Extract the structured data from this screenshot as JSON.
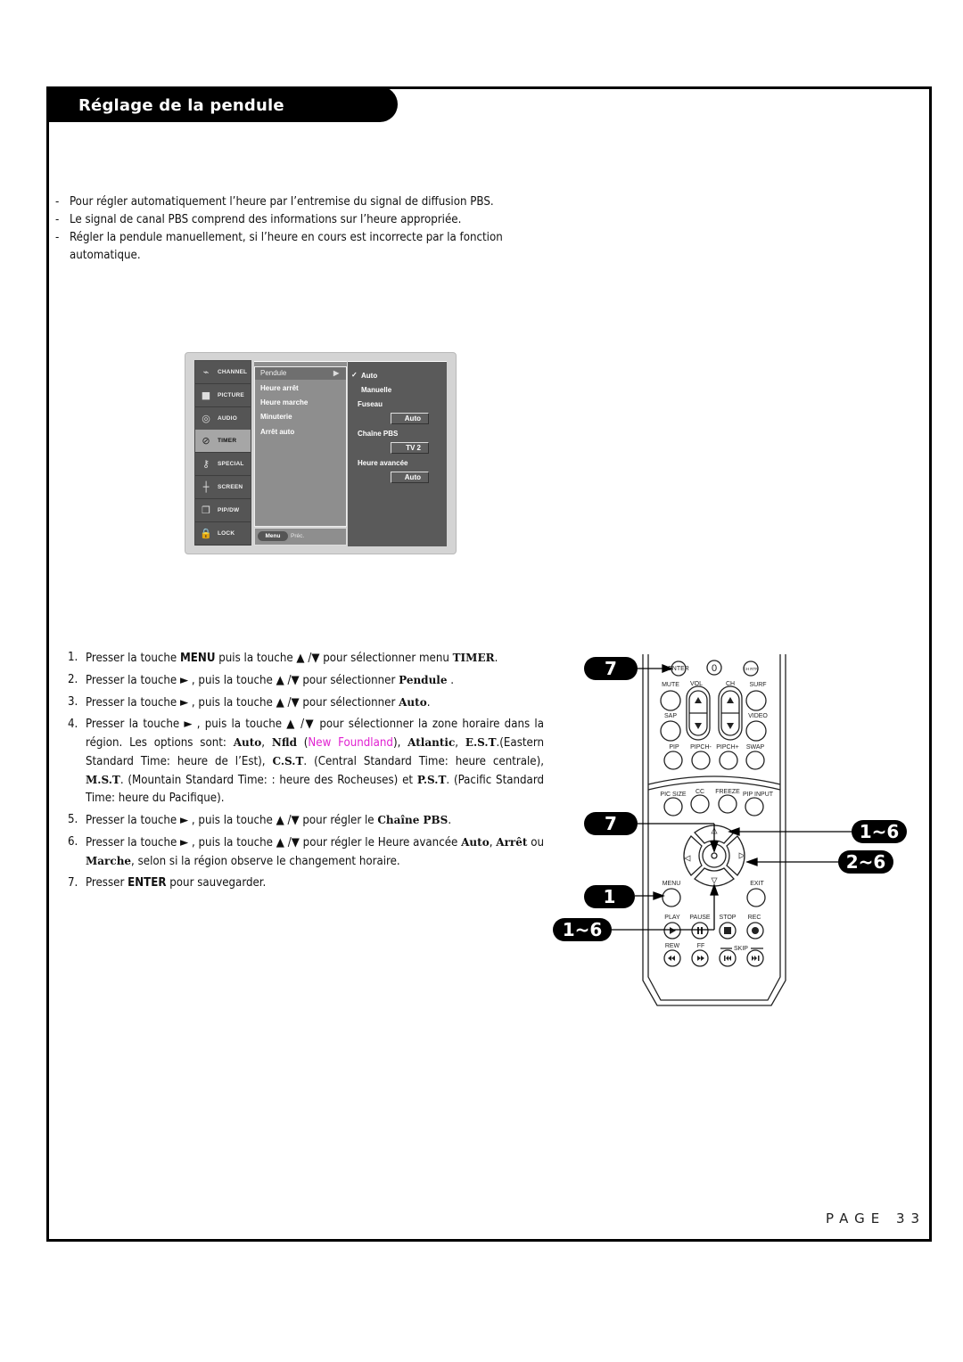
{
  "header": {
    "title": "Réglage de la pendule"
  },
  "intro": [
    "Pour régler automatiquement l’heure par l’entremise du signal de diffusion PBS.",
    "Le signal de canal PBS comprend des informations sur l’heure appropriée.",
    "Régler la pendule manuellement, si l’heure en cours est incorrecte par la fonction automatique."
  ],
  "osd": {
    "sidebar": [
      {
        "label": "CHANNEL",
        "icon": "satellite-dish-icon",
        "active": false
      },
      {
        "label": "PICTURE",
        "icon": "tv-screen-icon",
        "active": false
      },
      {
        "label": "AUDIO",
        "icon": "speaker-icon",
        "active": false
      },
      {
        "label": "TIMER",
        "icon": "clock-dial-icon",
        "active": true
      },
      {
        "label": "SPECIAL",
        "icon": "key-tag-icon",
        "active": false
      },
      {
        "label": "SCREEN",
        "icon": "crosshair-icon",
        "active": false
      },
      {
        "label": "PIP/DW",
        "icon": "pip-windows-icon",
        "active": false
      },
      {
        "label": "LOCK",
        "icon": "padlock-icon",
        "active": false
      }
    ],
    "submenu": [
      "Pendule",
      "Heure arrêt",
      "Heure marche",
      "Minuterie",
      "Arrêt auto"
    ],
    "submenu_arrow": "▶",
    "footer": {
      "menu": "Menu",
      "prev": "Préc."
    },
    "options": {
      "check": "✓",
      "auto": "Auto",
      "manual": "Manuelle",
      "fuseau_label": "Fuseau",
      "fuseau_value": "Auto",
      "pbs_label": "Chaîne PBS",
      "pbs_value": "TV 2",
      "dst_label": "Heure avancée",
      "dst_value": "Auto"
    }
  },
  "steps": {
    "s1": {
      "num": "1.",
      "a": "Presser la touche ",
      "b1": "MENU",
      "c": " puis la touche ▲ /▼ pour sélectionner menu ",
      "b2": "TIMER",
      "d": "."
    },
    "s2": {
      "num": "2.",
      "a": "Presser la touche ► , puis la touche ▲ /▼ pour sélectionner ",
      "b1": "Pendule",
      "d": " ."
    },
    "s3": {
      "num": "3.",
      "a": "Presser la touche ► , puis la touche ▲ /▼ pour sélectionner ",
      "b1": "Auto",
      "d": "."
    },
    "s4": {
      "num": "4.",
      "a": "Presser la touche ► , puis la touche ▲ /▼ pour sélectionner la zone horaire dans la région. Les options sont: ",
      "auto": "Auto",
      "nfld": "Nfld",
      "nf_full": "New Foundland",
      "atl": "Atlantic",
      "est": "E.S.T",
      "est_txt": ".(Eastern Standard Time: heure de l’Est), ",
      "cst": "C.S.T",
      "cst_txt": ". (Central Standard Time: heure centrale), ",
      "mst": "M.S.T",
      "mst_txt": ". (Mountain Standard Time: : heure des Rocheuses) et ",
      "pst": "P.S.T",
      "pst_txt": ". (Pacific Standard Time: heure du Pacifique)."
    },
    "s5": {
      "num": "5.",
      "a": "Presser la touche ► , puis la touche ▲ /▼ pour régler le ",
      "b1": "Chaîne PBS",
      "d": "."
    },
    "s6": {
      "num": "6.",
      "a": "Presser la touche ► , puis la touche ▲ /▼ pour régler le Heure avancée ",
      "o1": "Auto",
      "o2": "Arrêt",
      "ou": " ou ",
      "o3": "Marche",
      "d": ", selon si la région observe le changement horaire."
    },
    "s7": {
      "num": "7.",
      "a": "Presser ",
      "b1": "ENTER",
      "d": " pour sauvegarder."
    }
  },
  "remote": {
    "top": {
      "enter": "ENTER",
      "zero": "0",
      "chrtn": "CH RTN"
    },
    "row1": {
      "mute": "MUTE",
      "vol": "VOL",
      "ch": "CH",
      "surf": "SURF"
    },
    "row2": {
      "sap": "SAP",
      "video": "VIDEO"
    },
    "row3": [
      "PIP",
      "PIPCH-",
      "PIPCH+",
      "SWAP"
    ],
    "row4": [
      "PIC SIZE",
      "CC",
      "FREEZE",
      "PIP INPUT"
    ],
    "menu": "MENU",
    "exit": "EXIT",
    "transport1": [
      "PLAY",
      "PAUSE",
      "STOP",
      "REC"
    ],
    "transport2": [
      "REW",
      "FF"
    ],
    "skip": "SKIP"
  },
  "callouts": {
    "enter_step": "7",
    "ok_step": "7",
    "menu_step": "1",
    "down_step": "1~6",
    "up_step": "1~6",
    "right_step": "2~6"
  },
  "footer": {
    "page": "PAGE 33"
  }
}
